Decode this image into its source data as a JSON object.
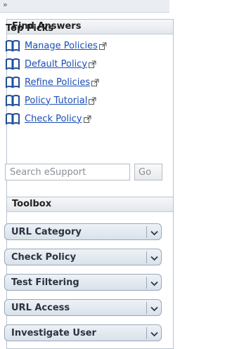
{
  "topbar": {
    "collapse_glyph": "»"
  },
  "find_answers": {
    "title": "Find Answers",
    "top_picks_title": "Top Picks",
    "picks": [
      {
        "label": "Manage Policies",
        "icon": "book-icon"
      },
      {
        "label": "Default Policy",
        "icon": "book-icon"
      },
      {
        "label": "Refine Policies",
        "icon": "book-icon"
      },
      {
        "label": "Policy Tutorial",
        "icon": "book-icon"
      },
      {
        "label": "Check Policy",
        "icon": "book-icon"
      }
    ],
    "search": {
      "placeholder": "Search eSupport",
      "go_label": "Go"
    }
  },
  "toolbox": {
    "title": "Toolbox",
    "tools": [
      {
        "label": "URL Category"
      },
      {
        "label": "Check Policy"
      },
      {
        "label": "Test Filtering"
      },
      {
        "label": "URL Access"
      },
      {
        "label": "Investigate User"
      }
    ]
  },
  "colors": {
    "link": "#1a4fb5",
    "book_icon": "#1f4e9c",
    "panel_border": "#b9c3cf",
    "tool_bg": "#d9e1ea"
  }
}
